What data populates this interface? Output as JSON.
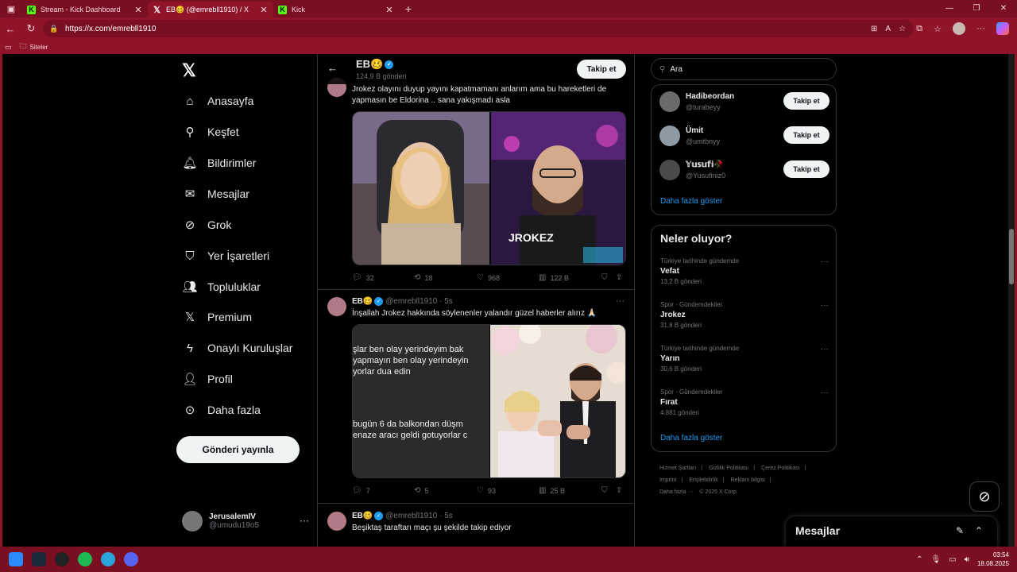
{
  "browser": {
    "tabs": [
      {
        "label": "Stream - Kick Dashboard",
        "icon": "kick"
      },
      {
        "label": "EB🥴 (@emrebll1910) / X",
        "icon": "x"
      },
      {
        "label": "Kick",
        "icon": "kick"
      }
    ],
    "url": "https://x.com/emrebll1910",
    "bookmarks_folder": "Siteler"
  },
  "nav": {
    "items": [
      {
        "label": "Anasayfa",
        "icon": "home-icon"
      },
      {
        "label": "Keşfet",
        "icon": "search-icon"
      },
      {
        "label": "Bildirimler",
        "icon": "bell-icon"
      },
      {
        "label": "Mesajlar",
        "icon": "mail-icon"
      },
      {
        "label": "Grok",
        "icon": "grok-icon"
      },
      {
        "label": "Yer İşaretleri",
        "icon": "bookmark-icon"
      },
      {
        "label": "Topluluklar",
        "icon": "people-icon"
      },
      {
        "label": "Premium",
        "icon": "x-icon"
      },
      {
        "label": "Onaylı Kuruluşlar",
        "icon": "lightning-icon"
      },
      {
        "label": "Profil",
        "icon": "person-icon"
      },
      {
        "label": "Daha fazla",
        "icon": "more-circle-icon"
      }
    ],
    "post_button": "Gönderi yayınla",
    "me": {
      "name": "JerusalemIV",
      "handle": "@umudu19o5"
    }
  },
  "header": {
    "name": "EB🥴",
    "count": "124,9 B gönderi",
    "follow": "Takip et"
  },
  "posts": [
    {
      "text": "Jrokez olayını duyup yayını kapatmamanı anlarım ama bu hareketleri de yapmasın be Eldorina .. sana yakışmadı asla",
      "overlay": "JROKEZ",
      "actions": {
        "replies": "32",
        "reposts": "18",
        "likes": "968",
        "views": "122 B"
      }
    },
    {
      "name": "EB🥴",
      "handle": "@emrebll1910",
      "time": "· 5s",
      "text": "İnşallah Jrokez hakkında söylenenler yalandır güzel haberler alırız 🙏🏻",
      "image_lines": [
        "şlar ben olay yerindeyim bak",
        "yapmayın ben olay yerindeyin",
        "yorlar dua edin",
        "",
        "bugün 6 da balkondan düşm",
        "enaze aracı geldi gotuyorlar c"
      ],
      "actions": {
        "replies": "7",
        "reposts": "5",
        "likes": "93",
        "views": "25 B"
      }
    },
    {
      "name": "EB🥴",
      "handle": "@emrebll1910",
      "time": "· 5s",
      "text": "Beşiktaş taraftarı maçı şu şekilde takip ediyor"
    }
  ],
  "search": {
    "placeholder": "Ara"
  },
  "who_to_follow": [
    {
      "name": "Hadibeordan",
      "handle": "@turabeyy",
      "button": "Takip et"
    },
    {
      "name": "Ümit",
      "handle": "@umtbnyy",
      "button": "Takip et"
    },
    {
      "name": "𝕐𝕦𝕤𝕦𝕗𝕚🥀",
      "handle": "@Yusufiniz0",
      "button": "Takip et"
    }
  ],
  "show_more": "Daha fazla göster",
  "trends": {
    "title": "Neler oluyor?",
    "items": [
      {
        "context": "Türkiye tarihinde gündemde",
        "name": "Vefat",
        "posts": "13,2 B gönderi"
      },
      {
        "context": "Spor · Gündemdekiler",
        "name": "Jrokez",
        "posts": "31,8 B gönderi"
      },
      {
        "context": "Türkiye tarihinde gündemde",
        "name": "Yarın",
        "posts": "30,6 B gönderi"
      },
      {
        "context": "Spor · Gündemdekiler",
        "name": "Fırat",
        "posts": "4.881 gönderi"
      }
    ],
    "show_more": "Daha fazla göster"
  },
  "footer": [
    "Hizmet Şartları",
    "|",
    "Gizlilik Politikası",
    "|",
    "Çerez Politikası",
    "|",
    "Imprint",
    "|",
    "Erişilebilirlik",
    "|",
    "Reklam bilgisi",
    "|",
    "Daha fazla ···",
    "© 2025 X Corp."
  ],
  "messages_drawer": {
    "title": "Mesajlar"
  },
  "clock": {
    "time": "03:54",
    "date": "18.08.2025"
  }
}
